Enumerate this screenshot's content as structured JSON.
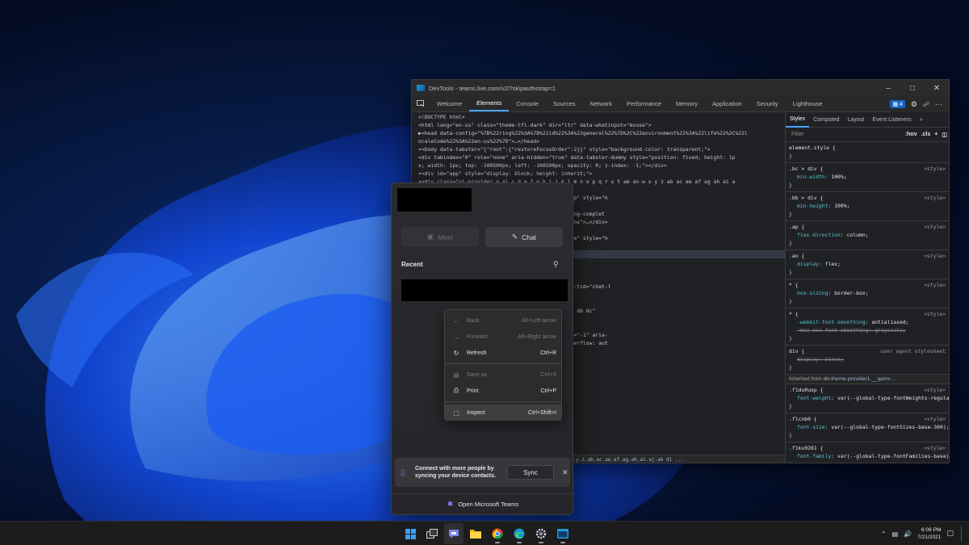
{
  "devtools": {
    "title": "DevTools - teams.live.com/v2/?skipauthstrap=1",
    "tabs": [
      "Welcome",
      "Elements",
      "Console",
      "Sources",
      "Network",
      "Performance",
      "Memory",
      "Application",
      "Security",
      "Lighthouse"
    ],
    "active_tab": "Elements",
    "issues_count": "4",
    "dom_lines": [
      "<!DOCTYPE html>",
      "<html lang=\"en-us\" class=\"theme-tfl-dark\" dir=\"ltr\" data-whatinput=\"mouse\">",
      "▶<head data-config=\"%7B%22ring%22%3A%7B%22id%22%3A%22general%22%7D%2C%22environment%22%3A%22life%22%2C%22l",
      "ocaleCode%22%3A%22en-us%22%7D\">…</head>",
      "▾<body data-tabster=\"{\"root\":{\"restoreFocusOrder\":2}}\" style=\"background-color: transparent;\">",
      "   <div tabindex=\"0\" role=\"none\" aria-hidden=\"true\" data-tabster-dummy style=\"position: fixed; height: 1p",
      "  x; width: 1px; top: -100500px; left: -100500px; opacity: 0; z-index: -1;\"></div>",
      " ▾<div id=\"app\" style=\"display: block; height: inherit;\">",
      "   ▾<div class=\"ui-provider a al c d e f g h i j k l m n o p q r s t am an w x y z ab ac ae af ag ah ai a",
      "                                                               dth: inherit;\">",
      "                                                              __qamxjn0 f16th3vw fpnz0vo f1kx0281 flcnb0 f1du0uop\" style=\"h",
      "                                                              nd: 0px center;\">",
      "",
      "                                                              au av ar aw ax ay aq\" data-tid=\"all-phased-rendering-complet",
      "",
      "                                                              t az aw ax\" data-tid=\"app-layout-area--notifications\">…</div>",
      "                                                              t bd aw ax\" data-tid=\"app-layout-area--main\">",
      "                                                              t-transition-appear-done slot-transition-enter-done\" style=\"h",
      "",
      "                                                              be ay bb bc\" data-tid=\"slot-measurer\">",
      "                                                                   == $0",
      "                                                              bi bj bk bl bm bn bo\">…</div>",
      "                                                              cp cq\">",
      "                                                              r cs bj bk bl\">…</div>",
      "                                                              ap aq ar be\" role=\"region\" aria-label=\"Chats\" data-tid=\"chat-l",
      "",
      "                                                              ay hu\">…</div>",
      "                                                              ap aq ar gh cs\">",
      "                                                              index=\"-1\" class=\"ms-FocusZone ui-tree gd dd lo da db dc\"",
      "                                                              cusZone2\" style=\"position: relative;\">",
      "                                                              ow: visible; height: 0px; width: 0px;\">",
      "                                                              px ip virtual-tree-list-scroll-container\" tabindex=\"-1\" aria-",
      "                                                              osition: relative; height: 387px; width: 362px; overflow: aut",
      "                                                              ransform; direction: ltr;\">…</div>",
      "",
      "                                                              t-triggers\">…</div>",
      "",
      "                                                              cy bh cr qx ky ke qz qk ra py db pz cn gu\">…</div>",
      "",
      "                                                              ao ap kt bj bk bl ku bz kv\">…</footer>"
    ],
    "breadcrumb": "...a.al.c.d.e.f.g.h.i.j.k.l.m.n.o.p.q.r.s.t.am.an.w.x.y.z.ab.ac.ae.af.ag.ah.ai.aj.ak   di   ...",
    "styles": {
      "tabs": [
        "Styles",
        "Computed",
        "Layout",
        "Event Listeners"
      ],
      "filter_placeholder": "Filter",
      "hov": ":hov",
      "cls": ".cls",
      "rules": [
        {
          "selector": "element.style {",
          "source": "",
          "props": []
        },
        {
          "selector": ".bc > div {",
          "source": "<style>",
          "props": [
            [
              "min-width",
              "100%;"
            ]
          ]
        },
        {
          "selector": ".bb > div {",
          "source": "<style>",
          "props": [
            [
              "min-height",
              "100%;"
            ]
          ]
        },
        {
          "selector": ".ap {",
          "source": "<style>",
          "props": [
            [
              "flex-direction",
              "column;"
            ]
          ]
        },
        {
          "selector": ".ao {",
          "source": "<style>",
          "props": [
            [
              "display",
              "flex;"
            ]
          ]
        },
        {
          "selector": "* {",
          "source": "<style>",
          "props": [
            [
              "box-sizing",
              "border-box;"
            ]
          ]
        },
        {
          "selector": "* {",
          "source": "<style>",
          "props": [
            [
              "-webkit-font-smoothing",
              "antialiased;"
            ],
            [
              "-moz-osx-font-smoothing",
              "grayscale;"
            ]
          ]
        },
        {
          "selector": "div {",
          "source": "user agent stylesheet",
          "props": [
            [
              "display",
              "block;"
            ]
          ]
        }
      ],
      "inherited_label": "Inherited from",
      "inherited_from": "div.theme-provider1.__qamx…",
      "inherited_rules": [
        {
          "selector": ".f1du0uop {",
          "source": "<style>",
          "props": [
            [
              "font-weight",
              "var(--global-type-fontWeights-regular);"
            ]
          ]
        },
        {
          "selector": ".flcnb0 {",
          "source": "<style>",
          "props": [
            [
              "font-size",
              "var(--global-type-fontSizes-base-300);"
            ]
          ]
        },
        {
          "selector": ".f1kx0281 {",
          "source": "<style>",
          "props": [
            [
              "font-family",
              "var(--global-type-fontFamilies-base);"
            ]
          ]
        }
      ]
    }
  },
  "teams": {
    "meet_label": "Meet",
    "chat_label": "Chat",
    "recent_label": "Recent",
    "sync_text": "Connect with more people by syncing your device contacts.",
    "sync_button": "Sync",
    "open_label": "Open Microsoft Teams"
  },
  "context_menu": {
    "items": [
      {
        "label": "Back",
        "shortcut": "Alt+Left arrow",
        "icon": "back-arrow-icon",
        "disabled": true
      },
      {
        "label": "Forward",
        "shortcut": "Alt+Right arrow",
        "icon": "forward-arrow-icon",
        "disabled": true
      },
      {
        "label": "Refresh",
        "shortcut": "Ctrl+R",
        "icon": "refresh-icon",
        "disabled": false
      },
      {
        "label": "Save as",
        "shortcut": "Ctrl+S",
        "icon": "save-icon",
        "disabled": true
      },
      {
        "label": "Print",
        "shortcut": "Ctrl+P",
        "icon": "print-icon",
        "disabled": false
      },
      {
        "label": "Inspect",
        "shortcut": "Ctrl+Shift+I",
        "icon": "inspect-icon",
        "disabled": false
      }
    ]
  },
  "taskbar": {
    "time": "6:06 PM",
    "date": "7/21/2021",
    "apps": [
      "windows-start-icon",
      "task-view-icon",
      "teams-chat-icon",
      "file-explorer-icon",
      "chrome-icon",
      "edge-icon",
      "settings-icon",
      "devtools-icon"
    ]
  }
}
